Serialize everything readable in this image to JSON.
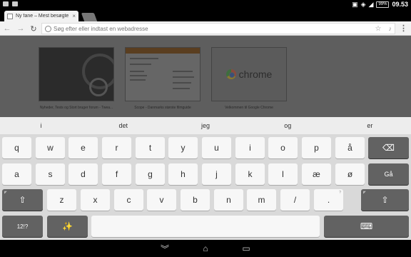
{
  "status": {
    "battery": "99%",
    "time": "09.53"
  },
  "tab": {
    "title": "Ny fane – Mest besøgte",
    "close": "×"
  },
  "toolbar": {
    "back": "←",
    "forward": "→",
    "reload": "↻",
    "menu": "⋮"
  },
  "omnibox": {
    "placeholder": "Søg efter eller indtast en webadresse",
    "star": "☆",
    "mic": "🎤"
  },
  "thumbnails": [
    {
      "caption": "Nyheder, Tests og Stort bruger forum - Twea..."
    },
    {
      "caption": "Scope - Danmarks største filmguide"
    },
    {
      "caption": "Velkommen til Google Chrome",
      "logo_word": "chrome"
    }
  ],
  "suggestions": [
    "i",
    "det",
    "jeg",
    "og",
    "er"
  ],
  "keyboard": {
    "row1": [
      "q",
      "w",
      "e",
      "r",
      "t",
      "y",
      "u",
      "i",
      "o",
      "p",
      "å"
    ],
    "row2": [
      "a",
      "s",
      "d",
      "f",
      "g",
      "h",
      "j",
      "k",
      "l",
      "æ",
      "ø"
    ],
    "row3": [
      "z",
      "x",
      "c",
      "v",
      "b",
      "n",
      "m",
      "/",
      "."
    ],
    "backspace": "⌫",
    "enter": "Gå",
    "shift": "⇧",
    "symbols": "12!?",
    "magic": "✨",
    "space": "",
    "hide": "⌨",
    "period_hint": "?",
    "shift_hint": "◤"
  },
  "nav": {
    "back": "︾",
    "home": "⌂",
    "recents": "▭"
  }
}
